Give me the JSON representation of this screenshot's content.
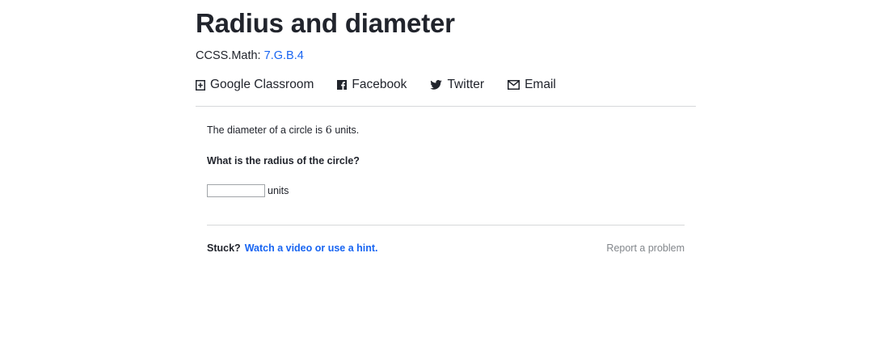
{
  "header": {
    "title": "Radius and diameter",
    "standard_prefix": "CCSS.Math:",
    "standard_code": "7.G.B.4"
  },
  "share": {
    "items": [
      {
        "label": "Google Classroom",
        "icon": "google-classroom-icon"
      },
      {
        "label": "Facebook",
        "icon": "facebook-icon"
      },
      {
        "label": "Twitter",
        "icon": "twitter-icon"
      },
      {
        "label": "Email",
        "icon": "email-icon"
      }
    ]
  },
  "exercise": {
    "statement_before": "The diameter of a circle is ",
    "statement_number": "6",
    "statement_after": " units.",
    "question": "What is the radius of the circle?",
    "answer_value": "",
    "answer_unit": "units"
  },
  "footer": {
    "stuck_label": "Stuck?",
    "hint_link": "Watch a video or use a hint.",
    "report_link": "Report a problem"
  },
  "colors": {
    "link": "#1865f2",
    "text": "#21242c",
    "muted": "#82868b",
    "divider": "#d6d8da"
  }
}
